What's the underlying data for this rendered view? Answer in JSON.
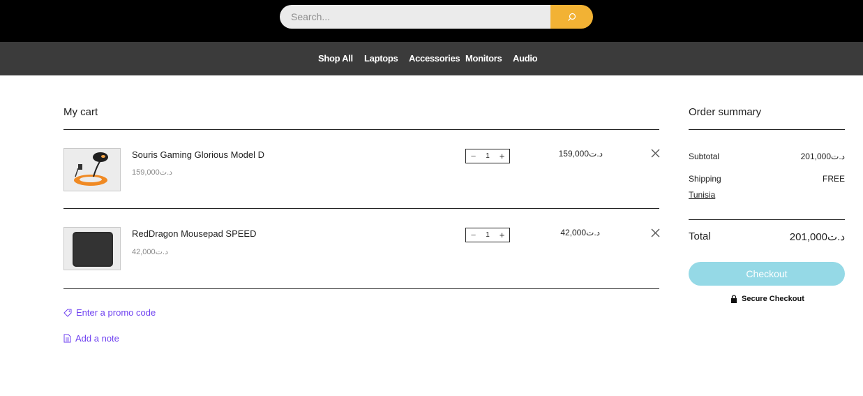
{
  "search": {
    "placeholder": "Search..."
  },
  "nav": {
    "items": [
      "Shop All",
      "Laptops",
      "Accessories",
      "Monitors",
      "Audio"
    ]
  },
  "cart": {
    "title": "My cart",
    "items": [
      {
        "name": "Souris Gaming Glorious Model D",
        "unit_price": "159,000د.ت",
        "quantity": "1",
        "total": "159,000د.ت",
        "minus": "−",
        "plus": "+"
      },
      {
        "name": "RedDragon Mousepad SPEED",
        "unit_price": "42,000د.ت",
        "quantity": "1",
        "total": "42,000د.ت",
        "minus": "−",
        "plus": "+"
      }
    ],
    "promo_label": "Enter a promo code",
    "note_label": "Add a note"
  },
  "summary": {
    "title": "Order summary",
    "subtotal_label": "Subtotal",
    "subtotal_value": "201,000د.ت",
    "shipping_label": "Shipping",
    "shipping_value": "FREE",
    "shipping_region": "Tunisia",
    "total_label": "Total",
    "total_value": "201,000د.ت",
    "checkout_label": "Checkout",
    "secure_label": "Secure Checkout"
  },
  "colors": {
    "topbar": "#000000",
    "nav": "#3b3b3b",
    "search_button": "#f2b234",
    "checkout_button": "#95d9e6",
    "link": "#6f42f0"
  },
  "icons": [
    "search-icon",
    "remove-icon",
    "tag-icon",
    "note-icon",
    "lock-icon"
  ]
}
